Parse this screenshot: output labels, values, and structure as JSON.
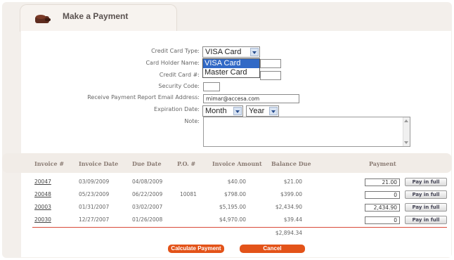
{
  "header": {
    "title": "Make a Payment",
    "icon": "credit-card-icon"
  },
  "form": {
    "card_type_label": "Credit Card Type:",
    "card_type_value": "VISA Card",
    "card_type_options": [
      "VISA Card",
      "Master Card"
    ],
    "holder_label": "Card Holder Name:",
    "card_number_label": "Credit Card #:",
    "security_label": "Security Code:",
    "email_label": "Receive Payment Report Email Address:",
    "email_value": "mimar@accesa.com",
    "expiration_label": "Expiration Date:",
    "month_value": "Month",
    "year_value": "Year",
    "note_label": "Note:"
  },
  "table": {
    "headers": [
      "Invoice #",
      "Invoice Date",
      "Due Date",
      "P.O. #",
      "Invoice Amount",
      "Balance Due",
      "Payment"
    ],
    "rows": [
      {
        "invoice": "20047",
        "invoice_date": "03/09/2009",
        "due_date": "04/08/2009",
        "po": "",
        "amount": "$40.00",
        "balance": "$21.00",
        "payment": "21.00"
      },
      {
        "invoice": "20048",
        "invoice_date": "05/23/2009",
        "due_date": "06/22/2009",
        "po": "10081",
        "amount": "$798.00",
        "balance": "$399.00",
        "payment": "0"
      },
      {
        "invoice": "20003",
        "invoice_date": "01/31/2007",
        "due_date": "03/02/2007",
        "po": "",
        "amount": "$5,195.00",
        "balance": "$2,434.90",
        "payment": "2,434.90"
      },
      {
        "invoice": "20030",
        "invoice_date": "12/27/2007",
        "due_date": "01/26/2008",
        "po": "",
        "amount": "$4,970.00",
        "balance": "$39.44",
        "payment": "0"
      }
    ],
    "pay_in_full_label": "Pay in full",
    "total_balance": "$2,894.34"
  },
  "actions": {
    "calculate_label": "Calculate Payment",
    "cancel_label": "Cancel"
  },
  "colors": {
    "accent": "#e35319",
    "header_bg": "#f1ece7",
    "selected_option": "#3169c6",
    "total_line": "#d94a3a"
  }
}
